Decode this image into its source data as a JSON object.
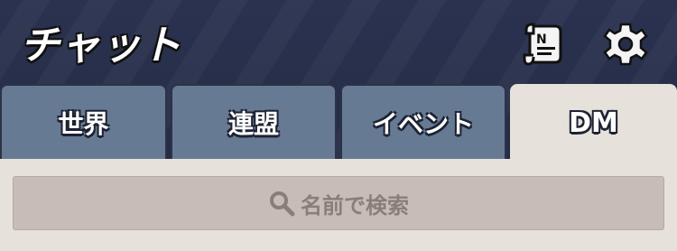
{
  "header": {
    "title": "チャット",
    "scroll_icon": "scroll-icon",
    "settings_icon": "gear-icon"
  },
  "tabs": [
    {
      "label": "世界",
      "active": false
    },
    {
      "label": "連盟",
      "active": false
    },
    {
      "label": "イベント",
      "active": false
    },
    {
      "label": "DM",
      "active": true
    }
  ],
  "search": {
    "placeholder": "名前で検索",
    "icon": "search-icon"
  },
  "colors": {
    "header_bg": "#262d47",
    "tab_inactive": "#677a93",
    "tab_active": "#e7e1dc",
    "search_bg": "#c8bcb8"
  }
}
